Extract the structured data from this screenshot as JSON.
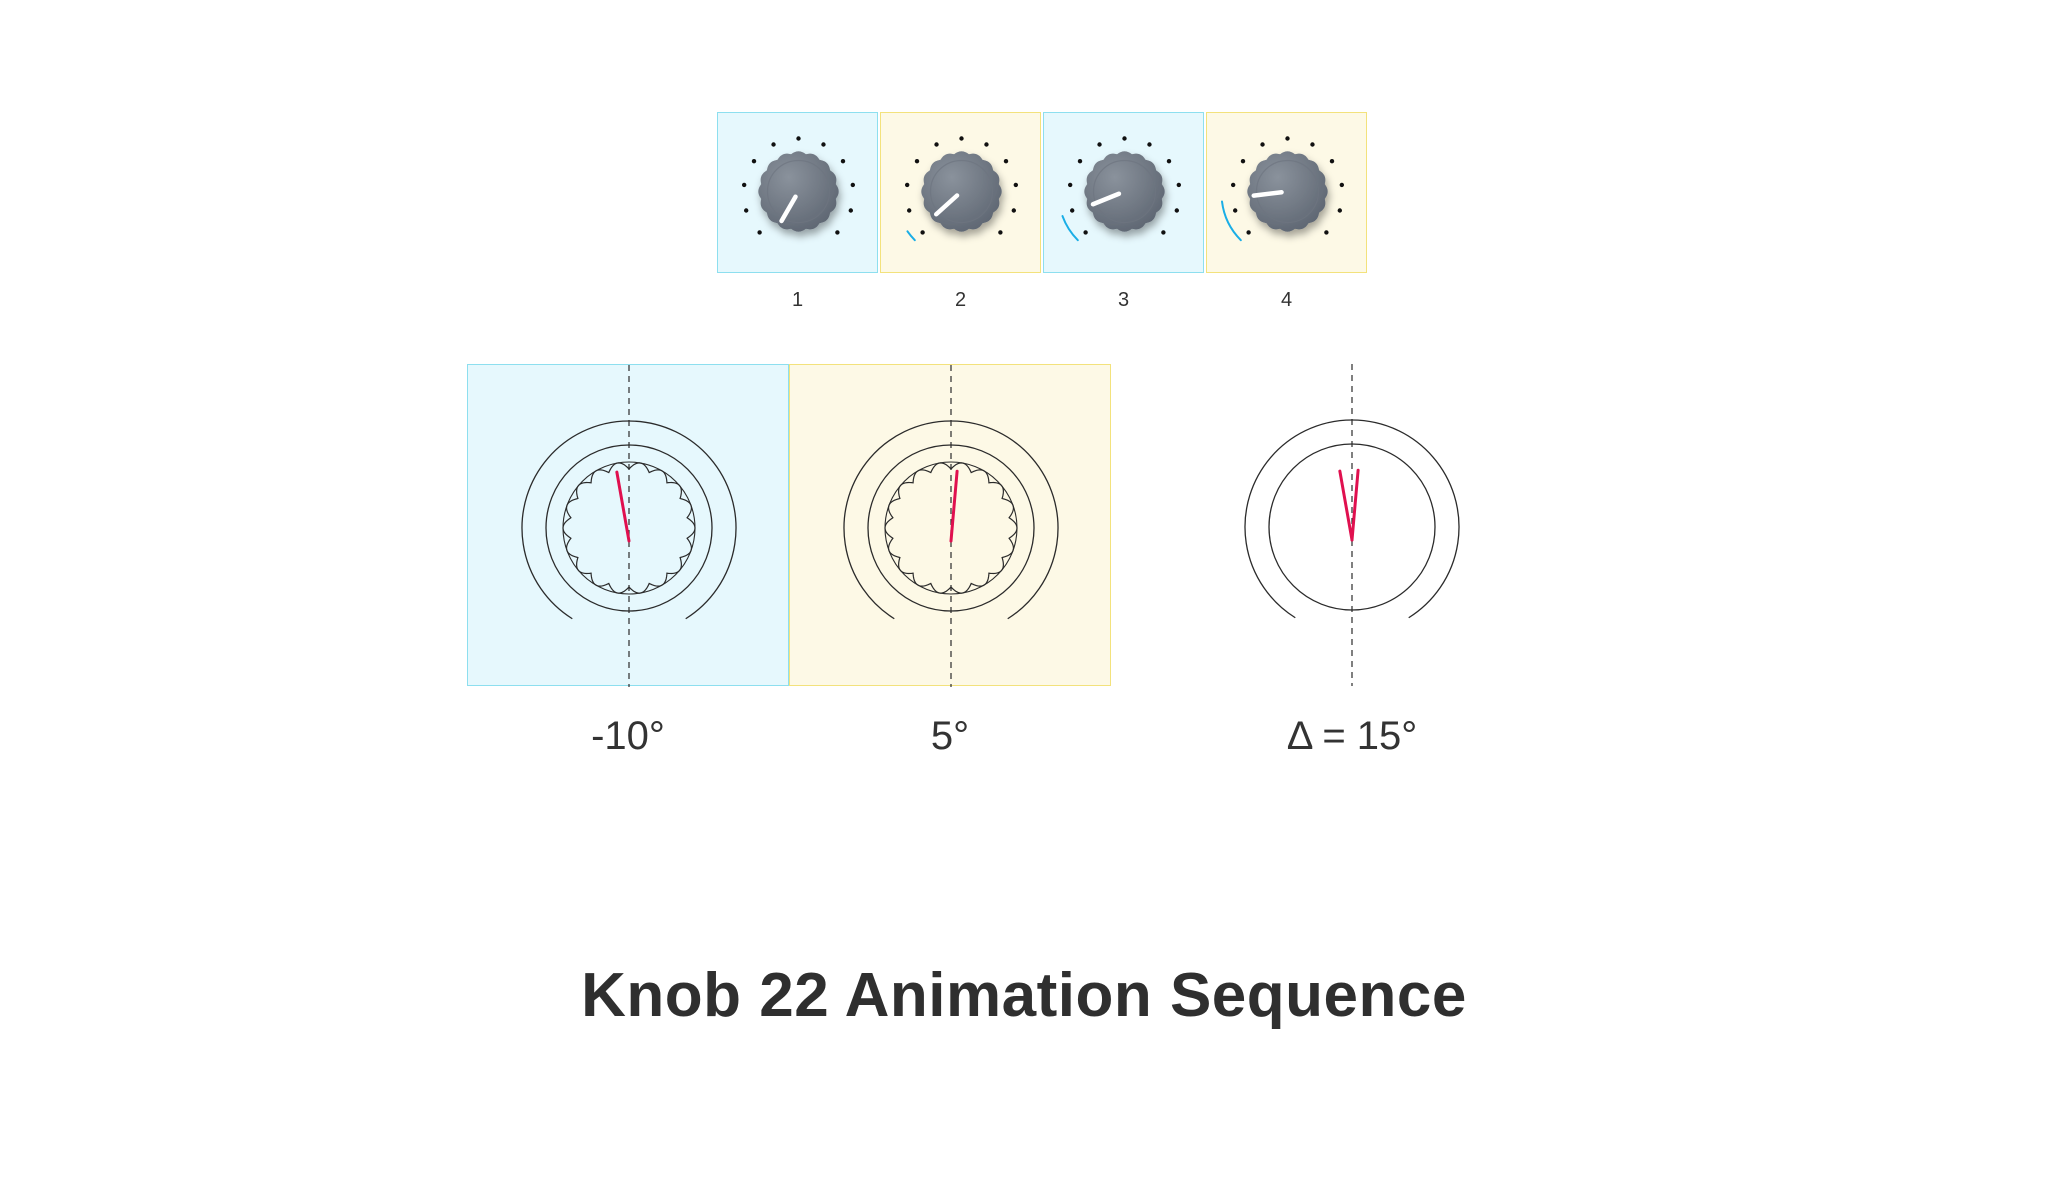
{
  "title": "Knob 22 Animation Sequence",
  "frames": [
    {
      "label": "1",
      "tint": "#e6f8fd",
      "border": "#8ddfef",
      "pointer_angle_deg": 210,
      "arc_sweep_deg": 0
    },
    {
      "label": "2",
      "tint": "#fdf9e6",
      "border": "#f3e27c",
      "pointer_angle_deg": 228,
      "arc_sweep_deg": 10
    },
    {
      "label": "3",
      "tint": "#e6f8fd",
      "border": "#8ddfef",
      "pointer_angle_deg": 248,
      "arc_sweep_deg": 25
    },
    {
      "label": "4",
      "tint": "#fdf9e6",
      "border": "#f3e27c",
      "pointer_angle_deg": 263,
      "arc_sweep_deg": 38
    }
  ],
  "details": [
    {
      "label": "-10°",
      "angle_deg": -10,
      "tint": "#e6f8fd",
      "border": "#8ddfef"
    },
    {
      "label": "5°",
      "angle_deg": 5,
      "tint": "#fdf9e6",
      "border": "#f3e27c"
    }
  ],
  "delta": {
    "label": "Δ = 15°",
    "from_deg": -10,
    "to_deg": 5
  },
  "colors": {
    "knob_body": "#5d6571",
    "knob_highlight": "#8a929c",
    "pointer": "#ffffff",
    "tick_dot": "#111111",
    "progress_arc": "#1aaee6",
    "outline": "#2b2b2b",
    "indicator": "#e0104f",
    "text": "#333333"
  },
  "icons": [
    "knob-icon",
    "tick-dot-icon",
    "progress-arc-icon",
    "pointer-line-icon",
    "dashed-axis-icon"
  ]
}
